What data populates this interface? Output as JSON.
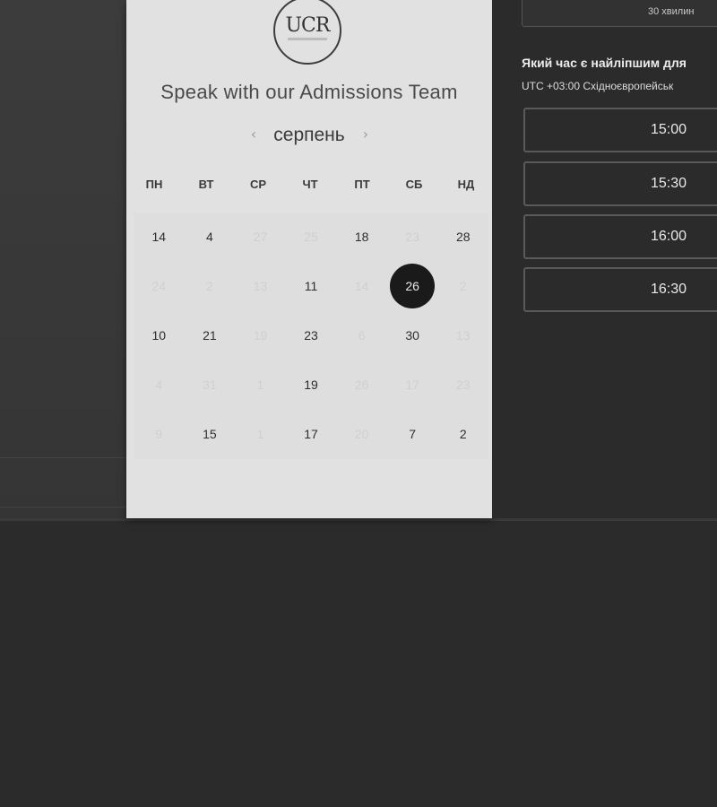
{
  "calendar": {
    "logo_text": "UCR",
    "title": "Speak with our Admissions Team",
    "month": "серпень",
    "prev_arrow": "‹",
    "next_arrow": "›",
    "weekdays": [
      "ПН",
      "ВТ",
      "СР",
      "ЧТ",
      "ПТ",
      "СБ",
      "НД"
    ],
    "weeks": [
      [
        {
          "d": "14",
          "m": false
        },
        {
          "d": "4",
          "m": false
        },
        {
          "d": "27",
          "m": true
        },
        {
          "d": "25",
          "m": true
        },
        {
          "d": "18",
          "m": false
        },
        {
          "d": "23",
          "m": true
        },
        {
          "d": "28",
          "m": false
        }
      ],
      [
        {
          "d": "24",
          "m": true
        },
        {
          "d": "2",
          "m": true
        },
        {
          "d": "13",
          "m": true
        },
        {
          "d": "11",
          "m": false
        },
        {
          "d": "14",
          "m": true
        },
        {
          "d": "26",
          "m": false,
          "selected": true
        },
        {
          "d": "2",
          "m": true
        }
      ],
      [
        {
          "d": "10",
          "m": false
        },
        {
          "d": "21",
          "m": false
        },
        {
          "d": "19",
          "m": true
        },
        {
          "d": "23",
          "m": false
        },
        {
          "d": "6",
          "m": true
        },
        {
          "d": "30",
          "m": false
        },
        {
          "d": "13",
          "m": true
        }
      ],
      [
        {
          "d": "4",
          "m": true
        },
        {
          "d": "31",
          "m": true
        },
        {
          "d": "1",
          "m": true
        },
        {
          "d": "19",
          "m": false
        },
        {
          "d": "26",
          "m": true
        },
        {
          "d": "17",
          "m": true
        },
        {
          "d": "23",
          "m": true
        }
      ],
      [
        {
          "d": "9",
          "m": true
        },
        {
          "d": "15",
          "m": false
        },
        {
          "d": "1",
          "m": true
        },
        {
          "d": "17",
          "m": false
        },
        {
          "d": "20",
          "m": true
        },
        {
          "d": "7",
          "m": false
        },
        {
          "d": "2",
          "m": false
        }
      ]
    ]
  },
  "booking": {
    "duration": "30 хвилин",
    "question": "Який час є найліпшим для",
    "timezone": "UTC +03:00 Східноєвропейськ",
    "slots": [
      "15:00",
      "15:30",
      "16:00",
      "16:30"
    ]
  }
}
